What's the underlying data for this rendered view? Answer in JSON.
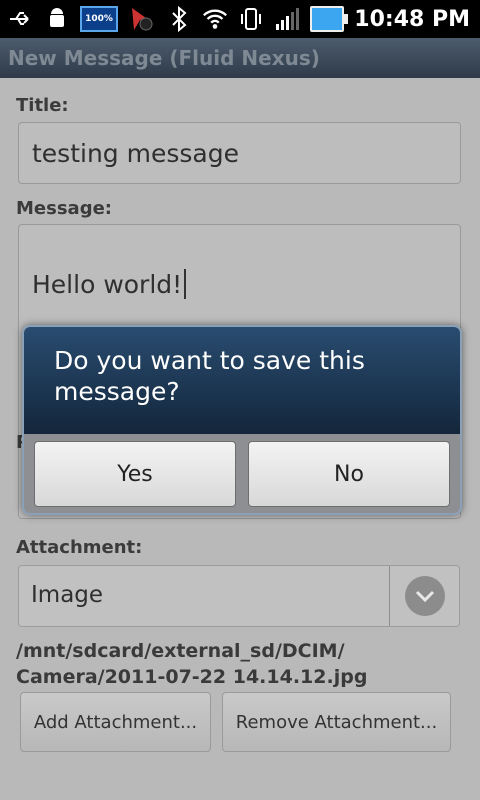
{
  "status_bar": {
    "time": "10:48 PM",
    "battery_percent_label": "100%",
    "icons": [
      "usb-icon",
      "android-debug-icon",
      "battery-percent-icon",
      "app-notification-icon",
      "bluetooth-icon",
      "wifi-icon",
      "vibrate-icon",
      "signal-icon",
      "battery-icon"
    ]
  },
  "title_bar": {
    "title": "New Message (Fluid Nexus)"
  },
  "form": {
    "title_label": "Title:",
    "title_value": "testing message",
    "message_label": "Message:",
    "message_value": "Hello world!",
    "hidden_label_char": "P",
    "attachment_label": "Attachment:",
    "attachment_type": "Image",
    "attachment_path": "/mnt/sdcard/external_sd/DCIM/\nCamera/2011-07-22 14.14.12.jpg",
    "add_attachment_label": "Add Attachment...",
    "remove_attachment_label": "Remove Attachment..."
  },
  "dialog": {
    "message": "Do you want to save this message?",
    "yes_label": "Yes",
    "no_label": "No"
  },
  "colors": {
    "title_bar_text": "#7e8994",
    "dialog_header": "#1c3654"
  }
}
